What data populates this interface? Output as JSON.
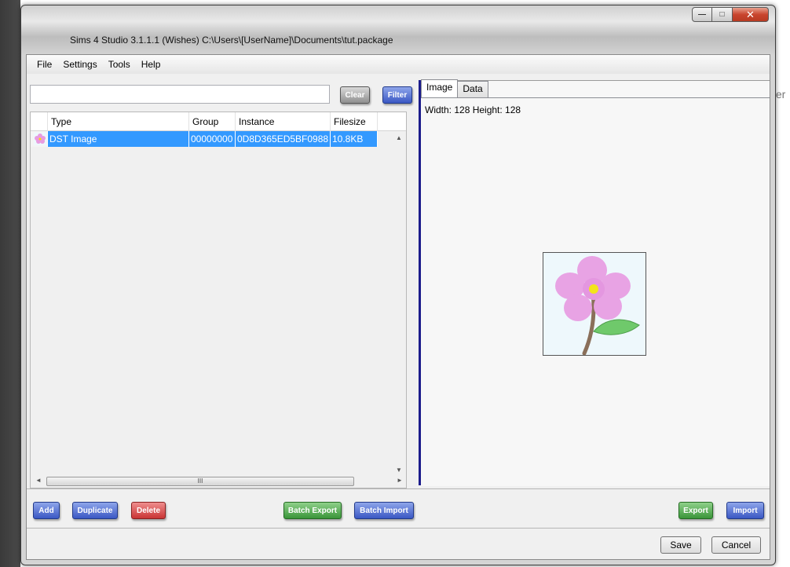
{
  "window": {
    "title": "Sims 4 Studio 3.1.1.1 (Wishes)  C:\\Users\\[UserName]\\Documents\\tut.package",
    "controls": {
      "minimize": "—",
      "maximize": "□",
      "close": "✕"
    }
  },
  "background": {
    "fragment": "ter"
  },
  "menu": {
    "items": [
      "File",
      "Settings",
      "Tools",
      "Help"
    ]
  },
  "filter": {
    "value": "",
    "clear_label": "Clear",
    "filter_label": "Filter"
  },
  "grid": {
    "columns": [
      "Type",
      "Group",
      "Instance",
      "Filesize"
    ],
    "rows": [
      {
        "type": "DST Image",
        "group": "00000000",
        "instance": "0D8D365ED5BF0988",
        "filesize": "10.8KB",
        "thumb_icon": "flower-thumbnail-icon"
      }
    ],
    "hscroll_grip": "III"
  },
  "tabs": [
    {
      "label": "Image",
      "active": true
    },
    {
      "label": "Data",
      "active": false
    }
  ],
  "preview": {
    "dimensions": "Width: 128 Height: 128",
    "image_icon": "pink-flower-image"
  },
  "actions": {
    "add": "Add",
    "duplicate": "Duplicate",
    "delete": "Delete",
    "batch_export": "Batch Export",
    "batch_import": "Batch Import",
    "export": "Export",
    "import": "Import"
  },
  "footer": {
    "save": "Save",
    "cancel": "Cancel"
  },
  "colors": {
    "selection": "#3399ff",
    "button_blue": "#3b58c4",
    "button_green": "#3b963a",
    "button_red": "#c93535",
    "splitter": "#1c1c8c"
  }
}
